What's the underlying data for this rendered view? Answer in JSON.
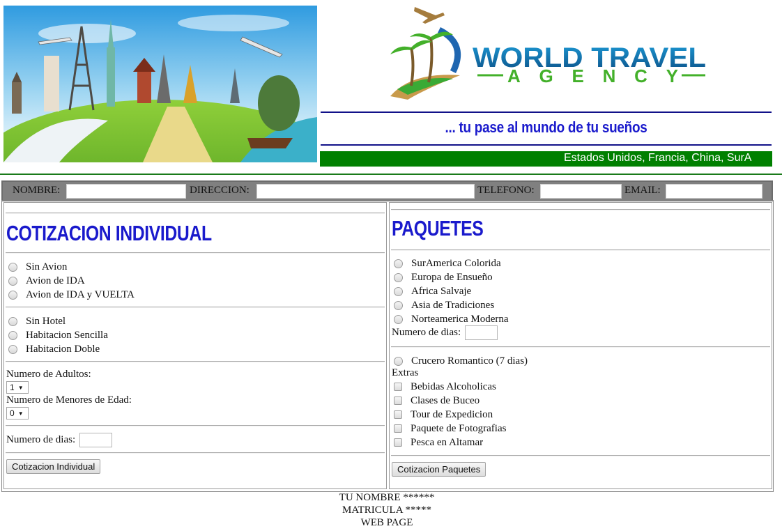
{
  "header": {
    "logo_line1": "WORLD TRAVEL",
    "logo_line2": "AGENCY",
    "slogan": "... tu pase al mundo de tu sueños",
    "marquee": "Estados Unidos, Francia, China, SurA"
  },
  "contact": {
    "nombre_label": "NOMBRE:",
    "direccion_label": "DIRECCION:",
    "telefono_label": "TELEFONO:",
    "email_label": "EMAIL:"
  },
  "individual": {
    "title": "COTIZACION INDIVIDUAL",
    "flight_options": [
      "Sin Avion",
      "Avion de IDA",
      "Avion de IDA y VUELTA"
    ],
    "hotel_options": [
      "Sin Hotel",
      "Habitacion Sencilla",
      "Habitacion Doble"
    ],
    "adults_label": "Numero de Adultos:",
    "adults_value": "1",
    "minors_label": "Numero de Menores de Edad:",
    "minors_value": "0",
    "days_label": "Numero de dias:",
    "button": "Cotizacion Individual"
  },
  "paquetes": {
    "title": "PAQUETES",
    "package_options": [
      "SurAmerica Colorida",
      "Europa de Ensueño",
      "Africa Salvaje",
      "Asia de Tradiciones",
      "Norteamerica Moderna"
    ],
    "days_label": "Numero de dias:",
    "cruise_option": "Crucero Romantico (7 dias)",
    "extras_label": "Extras",
    "extras": [
      "Bebidas Alcoholicas",
      "Clases de Buceo",
      "Tour de Expedicion",
      "Paquete de Fotografias",
      "Pesca en Altamar"
    ],
    "button": "Cotizacion Paquetes"
  },
  "footer": {
    "line1": "TU NOMBRE ******",
    "line2": "MATRICULA *****",
    "line3": "WEB PAGE"
  },
  "colors": {
    "title_blue": "#1a1acc",
    "marquee_green": "#008000",
    "bar_gray": "#808080",
    "navy": "#111189"
  }
}
